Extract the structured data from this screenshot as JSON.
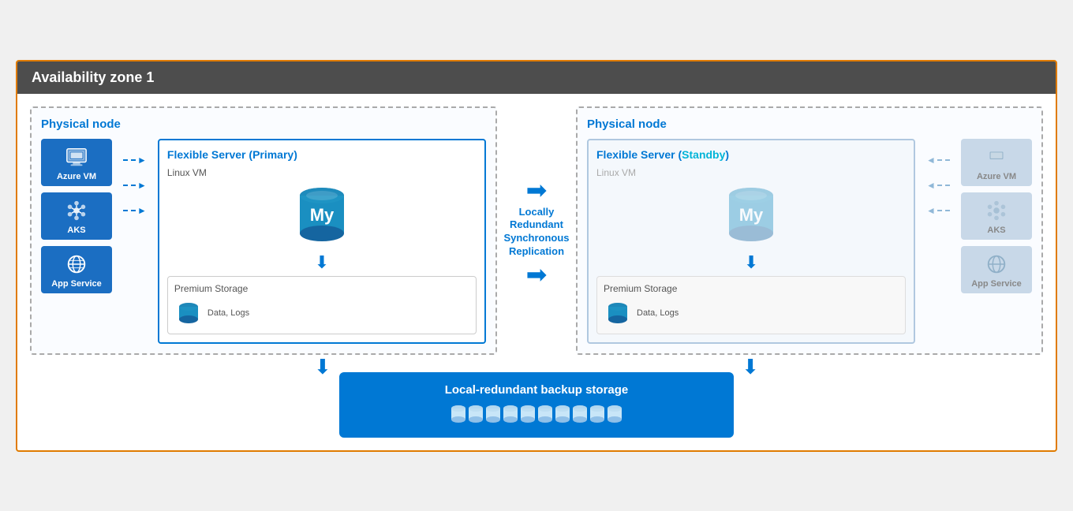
{
  "title": "Availability zone 1",
  "left_node": {
    "label": "Physical node",
    "server_title": "Flexible Server (",
    "server_mode": "Primary",
    "linux_vm": "Linux VM",
    "premium_storage": "Premium Storage",
    "data_logs": "Data, Logs",
    "apps": [
      {
        "name": "Azure VM",
        "icon": "vm"
      },
      {
        "name": "AKS",
        "icon": "aks"
      },
      {
        "name": "App Service",
        "icon": "app-service"
      }
    ]
  },
  "right_node": {
    "label": "Physical node",
    "server_title": "Flexible Server (",
    "server_mode": "Standby",
    "linux_vm": "Linux VM",
    "premium_storage": "Premium Storage",
    "data_logs": "Data, Logs",
    "apps": [
      {
        "name": "Azure VM",
        "icon": "vm"
      },
      {
        "name": "AKS",
        "icon": "aks"
      },
      {
        "name": "App Service",
        "icon": "app-service"
      }
    ]
  },
  "replication": {
    "label": "Locally\nRedundant\nSynchronous\nReplication"
  },
  "backup": {
    "label": "Local-redundant backup storage"
  }
}
